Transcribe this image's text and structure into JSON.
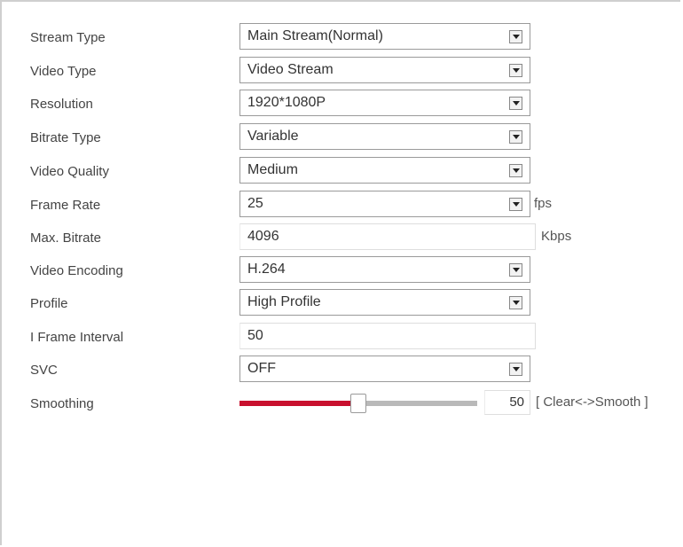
{
  "form": {
    "stream_type": {
      "label": "Stream Type",
      "value": "Main Stream(Normal)"
    },
    "video_type": {
      "label": "Video Type",
      "value": "Video Stream"
    },
    "resolution": {
      "label": "Resolution",
      "value": "1920*1080P"
    },
    "bitrate_type": {
      "label": "Bitrate Type",
      "value": "Variable"
    },
    "video_quality": {
      "label": "Video Quality",
      "value": "Medium"
    },
    "frame_rate": {
      "label": "Frame Rate",
      "value": "25",
      "unit": "fps"
    },
    "max_bitrate": {
      "label": "Max. Bitrate",
      "value": "4096",
      "unit": "Kbps"
    },
    "video_encoding": {
      "label": "Video Encoding",
      "value": "H.264"
    },
    "profile": {
      "label": "Profile",
      "value": "High Profile"
    },
    "i_frame_interval": {
      "label": "I Frame Interval",
      "value": "50"
    },
    "svc": {
      "label": "SVC",
      "value": "OFF"
    },
    "smoothing": {
      "label": "Smoothing",
      "value": "50",
      "level_fraction": 0.5,
      "hint": "[ Clear<->Smooth ]"
    }
  },
  "colors": {
    "slider_fill": "#c8102e",
    "slider_track": "#b9b9b9"
  },
  "icons": {
    "dropdown": "chevron-down-icon"
  }
}
